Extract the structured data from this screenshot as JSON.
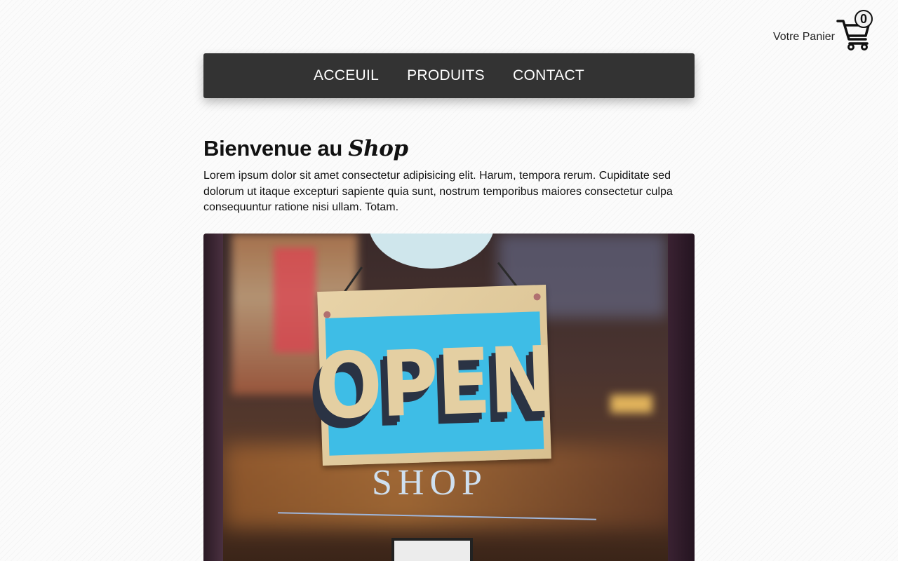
{
  "cart": {
    "label": "Votre Panier",
    "count": "0"
  },
  "nav": {
    "items": [
      {
        "label": "ACCEUIL"
      },
      {
        "label": "PRODUITS"
      },
      {
        "label": "CONTACT"
      }
    ]
  },
  "main": {
    "title_prefix": "Bienvenue au ",
    "title_brand": "Shop",
    "intro": "Lorem ipsum dolor sit amet consectetur adipisicing elit. Harum, tempora rerum. Cupiditate sed dolorum ut itaque excepturi sapiente quia sunt, nostrum temporibus maiores consectetur culpa consequuntur ratione nisi ullam. Totam."
  },
  "hero": {
    "sign_text": "OPEN",
    "window_text": "SHOP"
  },
  "icons": {
    "cart": "shopping-cart-icon"
  },
  "colors": {
    "navbar_bg": "#333333",
    "nav_text": "#ffffff",
    "sign_blue": "#3ebde6"
  }
}
